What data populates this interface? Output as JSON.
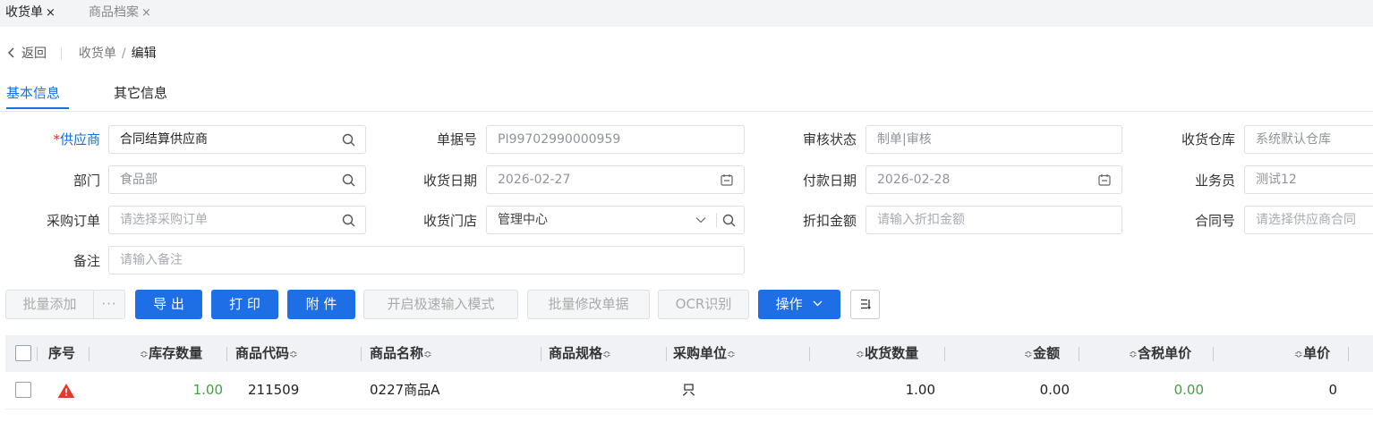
{
  "tabs": [
    {
      "label": "收货单",
      "close": "×"
    },
    {
      "label": "商品档案",
      "close": "×"
    }
  ],
  "breadcrumb": {
    "back": "返回",
    "path1": "收货单",
    "separator": "/",
    "path2": "编辑"
  },
  "subtabs": [
    "基本信息",
    "其它信息"
  ],
  "form": {
    "supplier": {
      "required_mark": "*",
      "label": "供应商",
      "value": "合同结算供应商"
    },
    "doc_no": {
      "label": "单据号",
      "value": "PI99702990000959"
    },
    "audit_status": {
      "label": "审核状态",
      "value": "制单|审核"
    },
    "warehouse": {
      "label": "收货仓库",
      "value": "系统默认仓库"
    },
    "department": {
      "label": "部门",
      "value": "食品部"
    },
    "receive_date": {
      "label": "收货日期",
      "value": "2026-02-27"
    },
    "pay_date": {
      "label": "付款日期",
      "value": "2026-02-28"
    },
    "salesman": {
      "label": "业务员",
      "value": "测试12"
    },
    "purchase_order": {
      "label": "采购订单",
      "placeholder": "请选择采购订单"
    },
    "store": {
      "label": "收货门店",
      "value": "管理中心"
    },
    "discount": {
      "label": "折扣金额",
      "placeholder": "请输入折扣金额"
    },
    "contract_no": {
      "label": "合同号",
      "placeholder": "请选择供应商合同"
    },
    "remark": {
      "label": "备注",
      "placeholder": "请输入备注"
    }
  },
  "toolbar": {
    "batch_add": "批量添加",
    "more": "···",
    "export": "导 出",
    "print": "打 印",
    "attach": "附 件",
    "fast_input": "开启极速输入模式",
    "batch_edit": "批量修改单据",
    "ocr": "OCR识别",
    "operate": "操作",
    "column_icon": "column-settings-icon"
  },
  "table": {
    "sort_glyph": "≎",
    "columns": [
      "序号",
      "库存数量",
      "商品代码",
      "商品名称",
      "商品规格",
      "采购单位",
      "收货数量",
      "金额",
      "含税单价",
      "单价"
    ],
    "rows": [
      {
        "stock": "1.00",
        "code": "211509",
        "name": "0227商品A",
        "spec": "",
        "unit": "只",
        "qty": "1.00",
        "amount": "0.00",
        "tax_price": "0.00",
        "price": "0"
      }
    ]
  },
  "colors": {
    "primary": "#1e6fe6",
    "link": "#1a6fe0",
    "required": "#f5222d",
    "warning": "#e8382b",
    "positive": "#3fa33f"
  }
}
